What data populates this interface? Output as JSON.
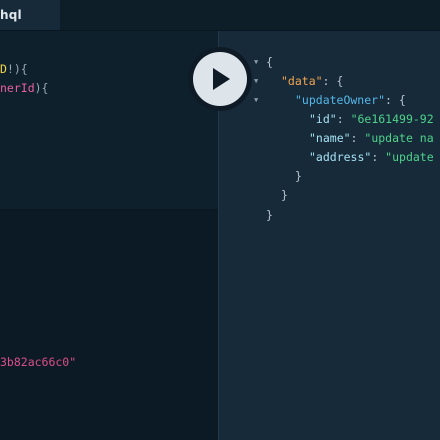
{
  "tab": {
    "title": "hql"
  },
  "query": {
    "line1": {
      "type": "D",
      "tail": "!){"
    },
    "line2": {
      "var": "nerId",
      "tail": "){"
    }
  },
  "variables": {
    "line1": "3b82ac66c0\""
  },
  "result": {
    "l1": "{",
    "l2_key": "\"data\"",
    "l2_tail": ": {",
    "l3_key": "\"updateOwner\"",
    "l3_tail": ": {",
    "l4_key": "\"id\"",
    "l4_sep": ": ",
    "l4_val": "\"6e161499-92",
    "l5_key": "\"name\"",
    "l5_sep": ": ",
    "l5_val": "\"update na",
    "l6_key": "\"address\"",
    "l6_sep": ": ",
    "l6_val": "\"update",
    "l7": "}",
    "l8": "}",
    "l9": "}"
  },
  "icons": {
    "run": "play-icon",
    "fold": "fold-arrow-icon"
  }
}
